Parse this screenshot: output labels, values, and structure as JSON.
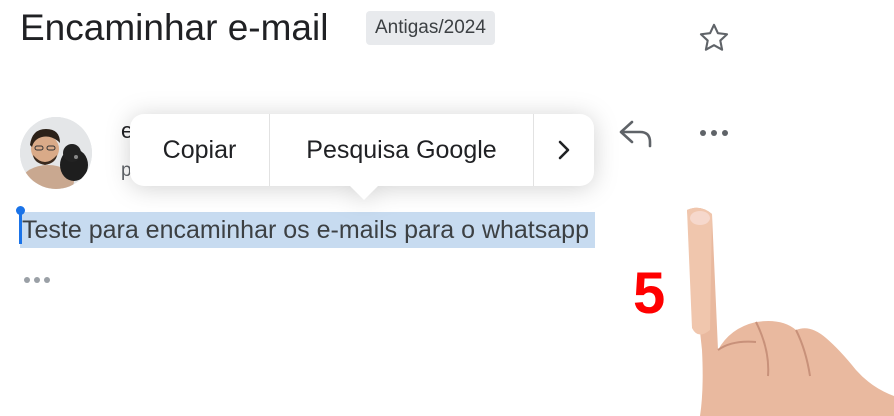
{
  "header": {
    "subject": "Encaminhar e-mail",
    "label": "Antigas/2024"
  },
  "sender": {
    "initial": "e",
    "sub_initial": "p"
  },
  "context_menu": {
    "copy": "Copiar",
    "search": "Pesquisa Google",
    "more": "›"
  },
  "message": {
    "body": "Teste para encaminhar os e-mails para o whatsapp"
  },
  "annotation": {
    "step": "5"
  },
  "icons": {
    "star": "star-outline-icon",
    "reply": "reply-icon",
    "more": "more-horizontal-icon",
    "expand": "ellipsis-icon"
  },
  "colors": {
    "selection": "#c7dbf0",
    "cursor": "#1a73e8",
    "step": "#ff0000"
  }
}
